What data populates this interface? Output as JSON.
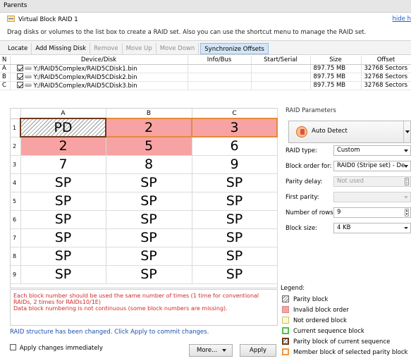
{
  "header": {
    "title": "Parents"
  },
  "vblock": {
    "name": "Virtual Block RAID 1",
    "hide_link": "hide h"
  },
  "hint": "Drag disks or volumes to the list box to create a RAID set. Also you can use the shortcut menu to manage the RAID set.",
  "toolbar": {
    "locate": "Locate",
    "add_missing": "Add Missing Disk",
    "remove": "Remove",
    "move_up": "Move Up",
    "move_down": "Move Down",
    "sync": "Synchronize Offsets"
  },
  "device_table": {
    "columns": [
      "N",
      "Device/Disk",
      "Info/Bus",
      "Start/Serial",
      "Size",
      "Offset"
    ],
    "rows": [
      {
        "n": "A",
        "path": "Y:/RAID5Complex/RAID5CDisk1.bin",
        "info": "",
        "start": "",
        "size": "897.75 MB",
        "offset": "32768 Sectors",
        "checked": true
      },
      {
        "n": "B",
        "path": "Y:/RAID5Complex/RAID5CDisk2.bin",
        "info": "",
        "start": "",
        "size": "897.75 MB",
        "offset": "32768 Sectors",
        "checked": true
      },
      {
        "n": "C",
        "path": "Y:/RAID5Complex/RAID5CDisk3.bin",
        "info": "",
        "start": "",
        "size": "897.75 MB",
        "offset": "32768 Sectors",
        "checked": true
      }
    ]
  },
  "grid": {
    "columns": [
      "A",
      "B",
      "C"
    ],
    "rows": [
      {
        "num": "1",
        "cells": [
          {
            "v": "PD",
            "state": "parity"
          },
          {
            "v": "2",
            "state": "invalid-current"
          },
          {
            "v": "3",
            "state": "invalid-current"
          }
        ]
      },
      {
        "num": "2",
        "cells": [
          {
            "v": "2",
            "state": "invalid"
          },
          {
            "v": "5",
            "state": "invalid"
          },
          {
            "v": "6",
            "state": ""
          }
        ]
      },
      {
        "num": "3",
        "cells": [
          {
            "v": "7",
            "state": ""
          },
          {
            "v": "8",
            "state": ""
          },
          {
            "v": "9",
            "state": ""
          }
        ]
      },
      {
        "num": "4",
        "cells": [
          {
            "v": "SP",
            "state": ""
          },
          {
            "v": "SP",
            "state": ""
          },
          {
            "v": "SP",
            "state": ""
          }
        ]
      },
      {
        "num": "5",
        "cells": [
          {
            "v": "SP",
            "state": ""
          },
          {
            "v": "SP",
            "state": ""
          },
          {
            "v": "SP",
            "state": ""
          }
        ]
      },
      {
        "num": "6",
        "cells": [
          {
            "v": "SP",
            "state": ""
          },
          {
            "v": "SP",
            "state": ""
          },
          {
            "v": "SP",
            "state": ""
          }
        ]
      },
      {
        "num": "7",
        "cells": [
          {
            "v": "SP",
            "state": ""
          },
          {
            "v": "SP",
            "state": ""
          },
          {
            "v": "SP",
            "state": ""
          }
        ]
      },
      {
        "num": "8",
        "cells": [
          {
            "v": "SP",
            "state": ""
          },
          {
            "v": "SP",
            "state": ""
          },
          {
            "v": "SP",
            "state": ""
          }
        ]
      },
      {
        "num": "9",
        "cells": [
          {
            "v": "SP",
            "state": ""
          },
          {
            "v": "SP",
            "state": ""
          },
          {
            "v": "SP",
            "state": ""
          }
        ]
      }
    ]
  },
  "messages": {
    "line1": "Each block number should be used the same number of times (1 time for conventional RAIDs, 2 times for RAIDs10/1E)",
    "line2": "Data block numbering is not continuous (some block numbers are missing)."
  },
  "status": "RAID structure has been changed. Click Apply to commit changes.",
  "bottom": {
    "apply_immediately": "Apply changes immediately",
    "more": "More...",
    "apply": "Apply"
  },
  "params": {
    "title": "RAID Parameters",
    "auto_detect": "Auto Detect",
    "raid_type_label": "RAID type:",
    "raid_type": "Custom",
    "block_order_label": "Block order for:",
    "block_order": "RAID0 (Stripe set) - De",
    "parity_delay_label": "Parity delay:",
    "parity_delay": "Not used",
    "first_parity_label": "First parity:",
    "first_parity": "",
    "rows_label": "Number of rows:",
    "rows": "9",
    "block_size_label": "Block size:",
    "block_size": "4 KB"
  },
  "legend": {
    "title": "Legend:",
    "items": [
      "Parity block",
      "Invalid block order",
      "Not ordered block",
      "Current sequence block",
      "Parity block of current sequence",
      "Member block of selected parity block"
    ]
  },
  "colors": {
    "invalid": "#f7a3a3",
    "current_border": "#e58a3b",
    "parity_border": "#6b3a1d",
    "link": "#1a5fd0",
    "error_text": "#d12a2a"
  }
}
